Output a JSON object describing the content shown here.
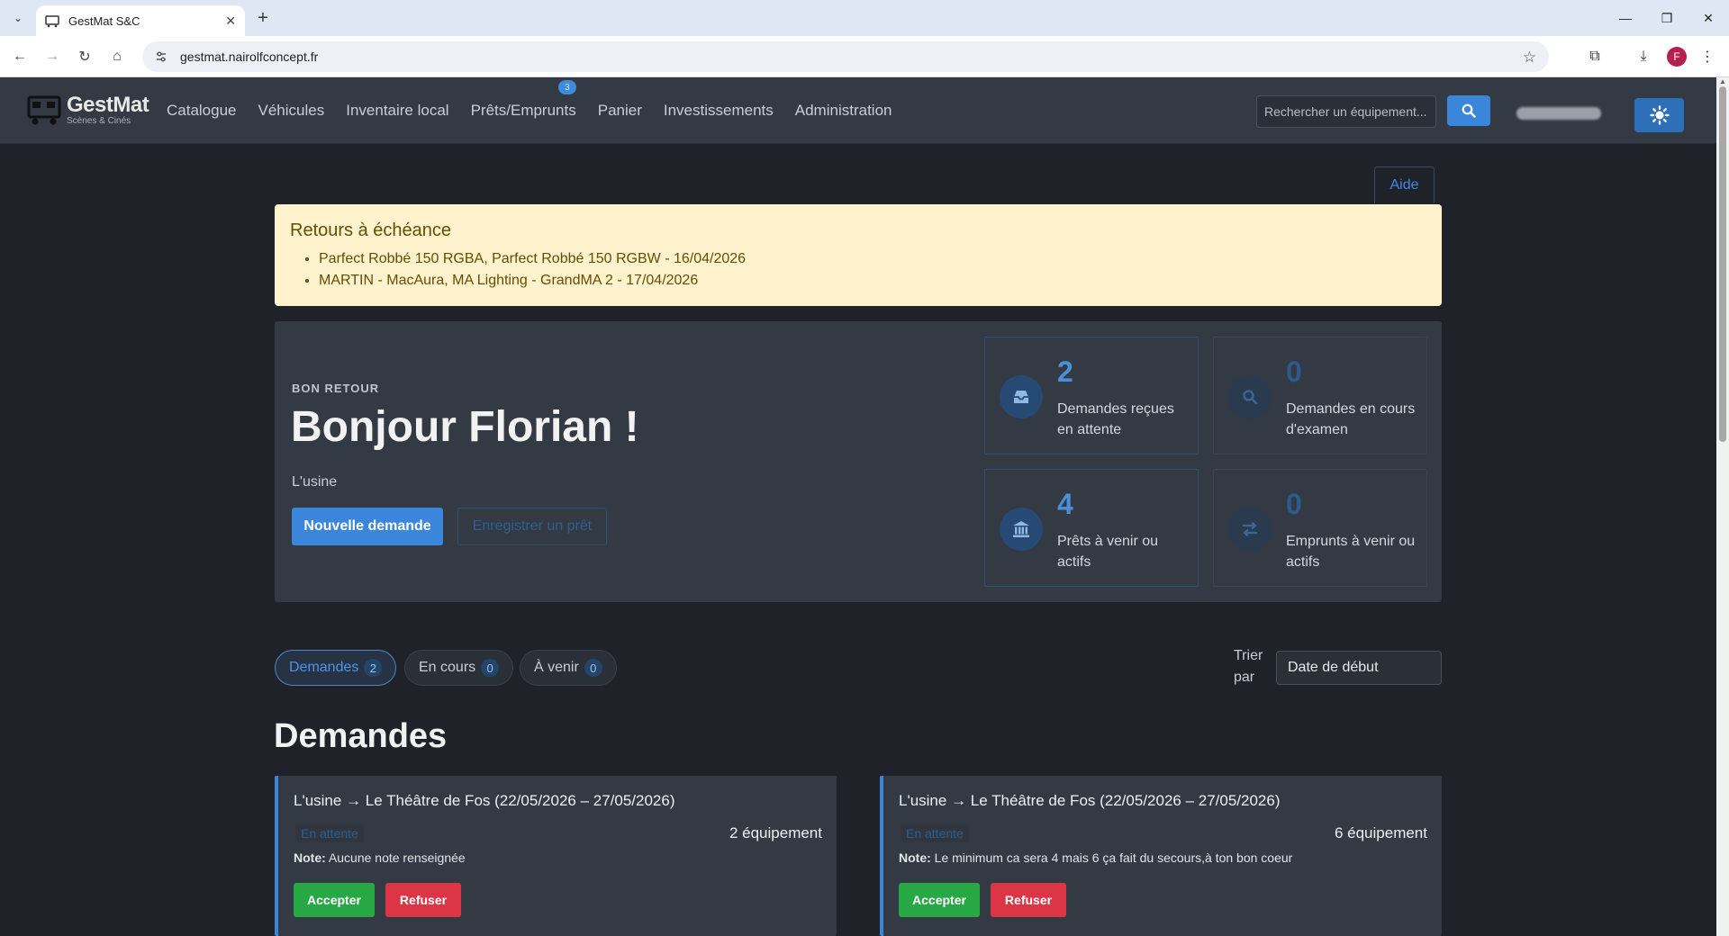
{
  "browser": {
    "tab_title": "GestMat S&C",
    "url": "gestmat.nairolfconcept.fr",
    "profile_initial": "F"
  },
  "app": {
    "logo_title": "GestMat",
    "logo_subtitle": "Scènes & Cinés",
    "nav": {
      "catalogue": "Catalogue",
      "vehicules": "Véhicules",
      "inventaire": "Inventaire local",
      "prets": "Prêts/Emprunts",
      "prets_badge": "3",
      "panier": "Panier",
      "investissements": "Investissements",
      "administration": "Administration"
    },
    "search_placeholder": "Rechercher un équipement..."
  },
  "help_label": "Aide",
  "alert": {
    "title": "Retours à échéance",
    "items": [
      "Parfect Robbé 150 RGBA, Parfect Robbé 150 RGBW - 16/04/2026",
      "MARTIN - MacAura, MA Lighting - GrandMA 2 - 17/04/2026"
    ]
  },
  "hero": {
    "eyebrow": "BON RETOUR",
    "title": "Bonjour Florian !",
    "subtitle": "L'usine",
    "primary_button": "Nouvelle demande",
    "secondary_button": "Enregistrer un prêt"
  },
  "stats": [
    {
      "value": "2",
      "label": "Demandes reçues en attente",
      "icon": "inbox-icon"
    },
    {
      "value": "0",
      "label": "Demandes en cours d'examen",
      "icon": "search-icon"
    },
    {
      "value": "4",
      "label": "Prêts à venir ou actifs",
      "icon": "bank-icon"
    },
    {
      "value": "0",
      "label": "Emprunts à venir ou actifs",
      "icon": "exchange-icon"
    }
  ],
  "filters": [
    {
      "label": "Demandes",
      "count": "2"
    },
    {
      "label": "En cours",
      "count": "0"
    },
    {
      "label": "À venir",
      "count": "0"
    }
  ],
  "sort": {
    "label": "Trier par",
    "value": "Date de début"
  },
  "section_title": "Demandes",
  "requests": [
    {
      "route": "L'usine → Le Théâtre de Fos (22/05/2026 – 27/05/2026)",
      "status": "En attente",
      "count": "2 équipement",
      "note_label": "Note:",
      "note": "Aucune note renseignée",
      "accept": "Accepter",
      "refuse": "Refuser"
    },
    {
      "route": "L'usine → Le Théâtre de Fos (22/05/2026 – 27/05/2026)",
      "status": "En attente",
      "count": "6 équipement",
      "note_label": "Note:",
      "note": "Le minimum ca sera 4 mais 6 ça fait du secours,à ton bon coeur",
      "accept": "Accepter",
      "refuse": "Refuser"
    }
  ],
  "colors": {
    "accent": "#3b86db",
    "success": "#28a745",
    "danger": "#dc3545",
    "warning_bg": "#fff3cd"
  }
}
